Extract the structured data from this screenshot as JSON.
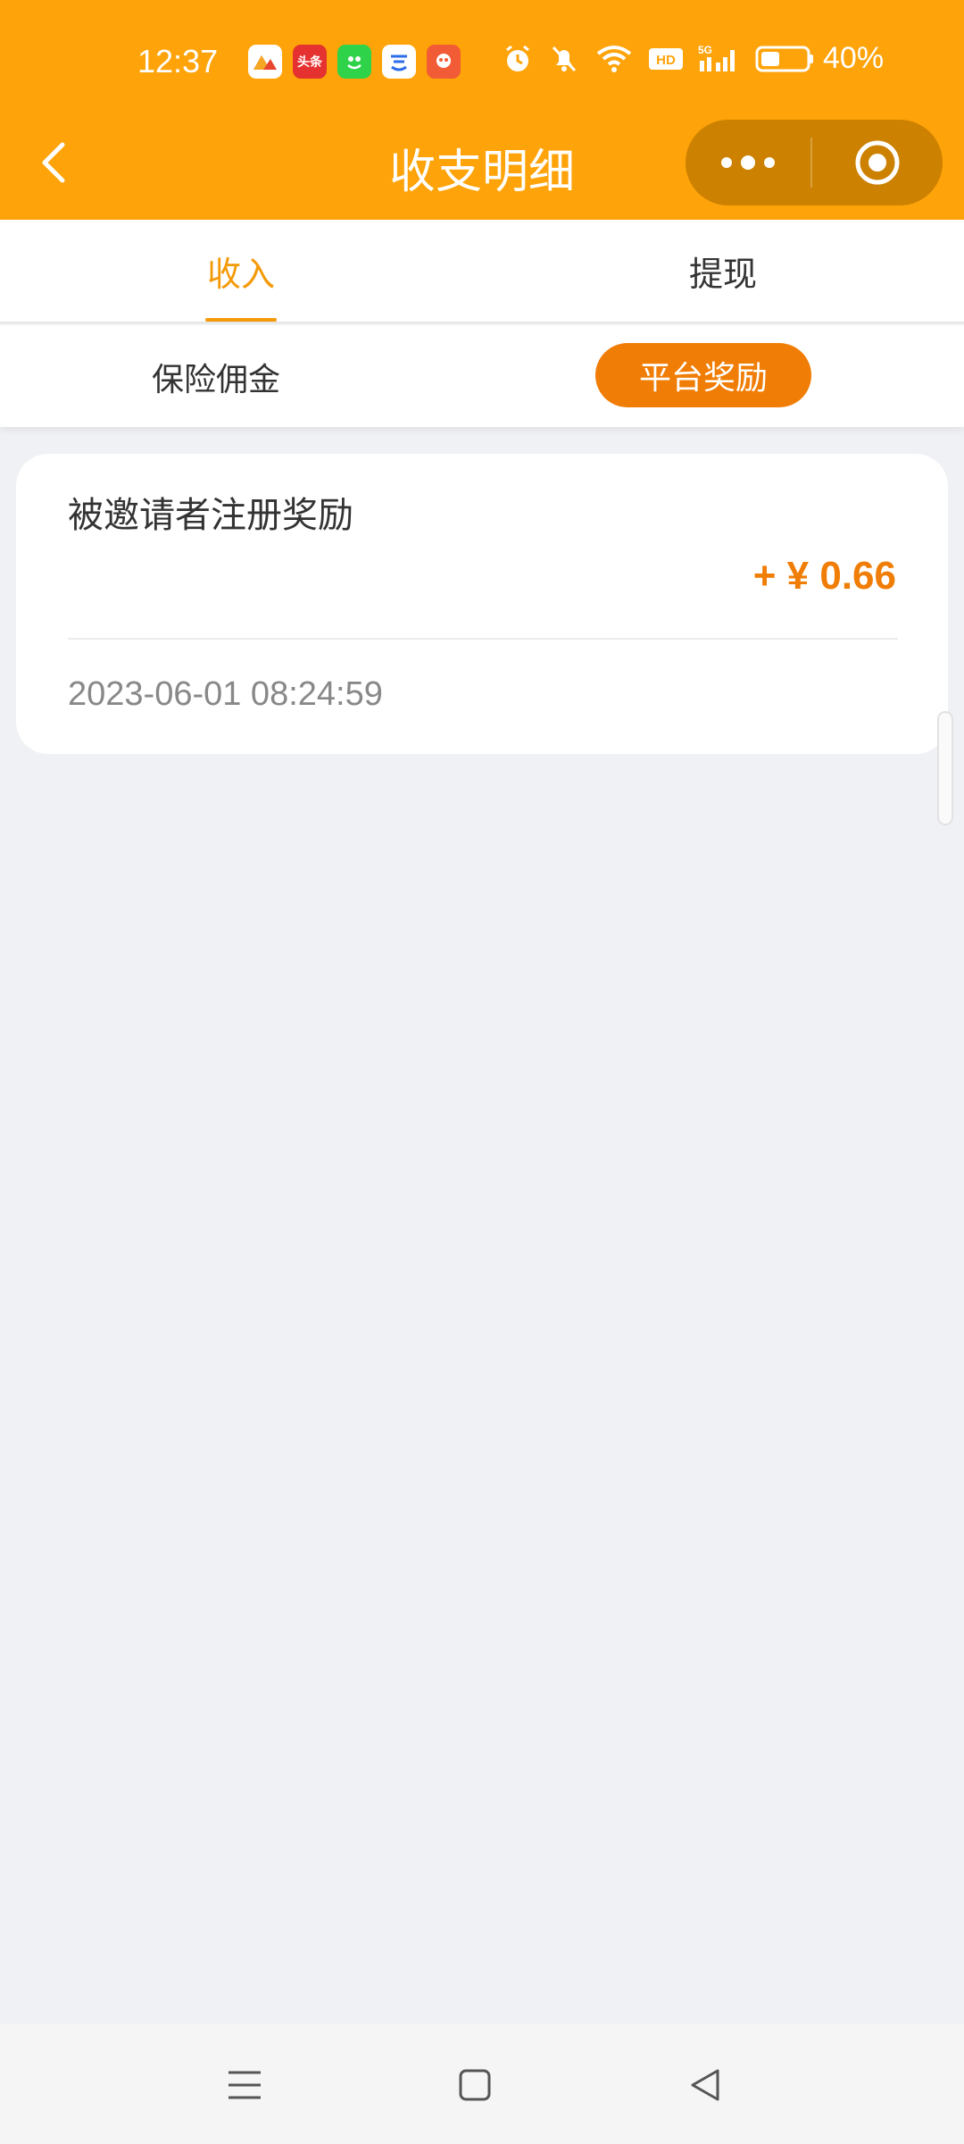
{
  "status_bar": {
    "time": "12:37",
    "battery": "40%",
    "apps": [
      {
        "icon": "app-icon-1",
        "color": "#ffffff"
      },
      {
        "icon": "toutiao-icon",
        "label": "头条",
        "color": "#e5312f"
      },
      {
        "icon": "green-app-icon",
        "color": "#2fd34a"
      },
      {
        "icon": "cloud-app-icon",
        "color": "#ffffff"
      },
      {
        "icon": "red-app-icon",
        "color": "#f15b35"
      }
    ]
  },
  "navbar": {
    "title": "收支明细"
  },
  "tabs": {
    "income": "收入",
    "withdraw": "提现"
  },
  "subtabs": {
    "commission": "保险佣金",
    "reward": "平台奖励"
  },
  "records": [
    {
      "title": "被邀请者注册奖励",
      "amount": "+ ¥ 0.66",
      "time": "2023-06-01 08:24:59"
    }
  ],
  "colors": {
    "header": "#fea309",
    "accent": "#f07d06",
    "background": "#f0f1f5"
  }
}
